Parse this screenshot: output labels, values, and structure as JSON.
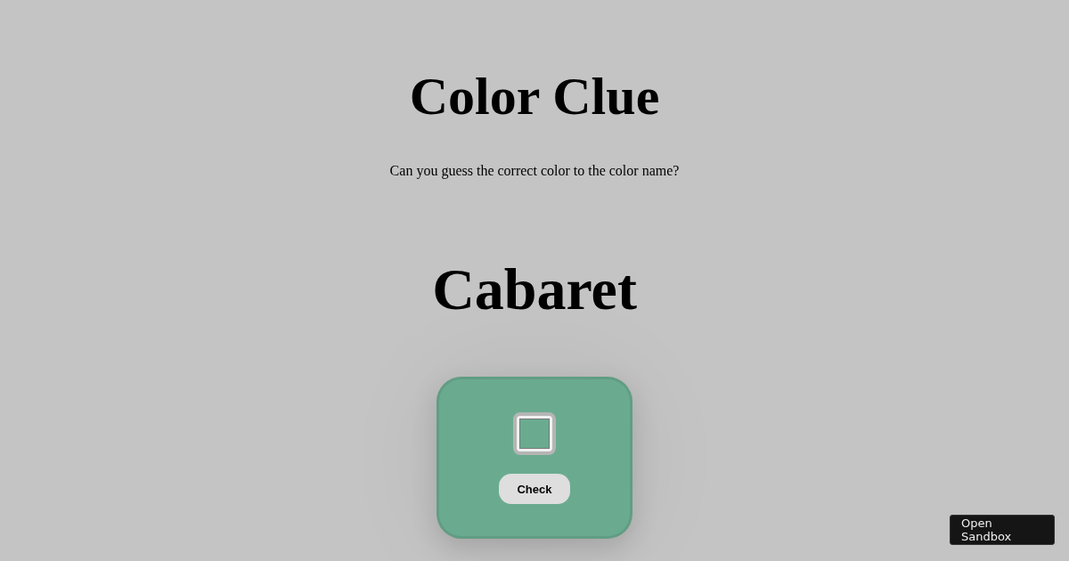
{
  "title": "Color Clue",
  "subtitle": "Can you guess the correct color to the color name?",
  "color_name": "Cabaret",
  "picker": {
    "color": "#6aab90"
  },
  "check_button": "Check",
  "sandbox_button": "Open Sandbox"
}
